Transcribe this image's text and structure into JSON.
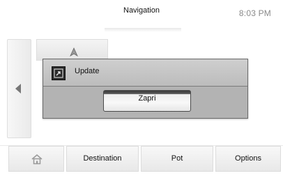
{
  "header": {
    "title": "Navigation",
    "clock": "8:03 PM"
  },
  "sidebar": {
    "back_icon": "left-arrow-icon"
  },
  "dialog": {
    "title": "Update",
    "icon": "update-icon",
    "close_label": "Zapri"
  },
  "bottom_bar": {
    "home_icon": "home-icon",
    "destination_label": "Destination",
    "pot_label": "Pot",
    "options_label": "Options"
  },
  "colors": {
    "dialog_bg": "#b3b3b3",
    "dialog_border": "#6a6a6a",
    "clock": "#8a8a8a"
  }
}
